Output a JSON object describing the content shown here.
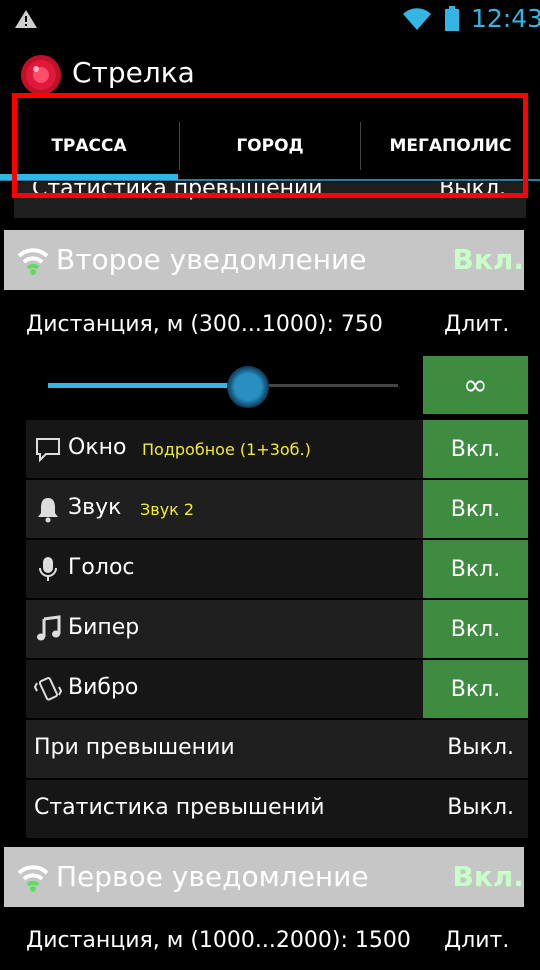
{
  "status": {
    "time": "12:43"
  },
  "app": {
    "title": "Стрелка"
  },
  "tabs": [
    {
      "label": "ТРАССА",
      "selected": true
    },
    {
      "label": "ГОРОД"
    },
    {
      "label": "МЕГАПОЛИС"
    }
  ],
  "partial_row": {
    "label": "Статистика превышений",
    "value": "Выкл."
  },
  "second_notification": {
    "title": "Второе уведомление",
    "state": "Вкл.",
    "distance_label": "Дистанция, м (300...1000): 750",
    "duration_label": "Длит.",
    "slider": {
      "min": 300,
      "max": 1000,
      "value": 750
    },
    "duration_value": "∞",
    "options": [
      {
        "icon": "window-icon",
        "label": "Окно",
        "detail": "Подробное (1+3об.)",
        "value": "Вкл."
      },
      {
        "icon": "bell-icon",
        "label": "Звук",
        "detail": "Звук 2",
        "value": "Вкл."
      },
      {
        "icon": "microphone-icon",
        "label": "Голос",
        "detail": "",
        "value": "Вкл."
      },
      {
        "icon": "music-note-icon",
        "label": "Бипер",
        "detail": "",
        "value": "Вкл."
      },
      {
        "icon": "vibrate-icon",
        "label": "Вибро",
        "detail": "",
        "value": "Вкл."
      }
    ],
    "on_speeding": {
      "label": "При превышении",
      "value": "Выкл."
    },
    "statistics": {
      "label": "Статистика превышений",
      "value": "Выкл."
    }
  },
  "first_notification": {
    "title": "Первое уведомление",
    "state": "Вкл.",
    "distance_label": "Дистанция, м (1000...2000): 1500",
    "duration_label": "Длит."
  },
  "colors": {
    "accent": "#33b5e5",
    "toggle_on": "#3d8c40",
    "highlight": "#ff0000"
  }
}
